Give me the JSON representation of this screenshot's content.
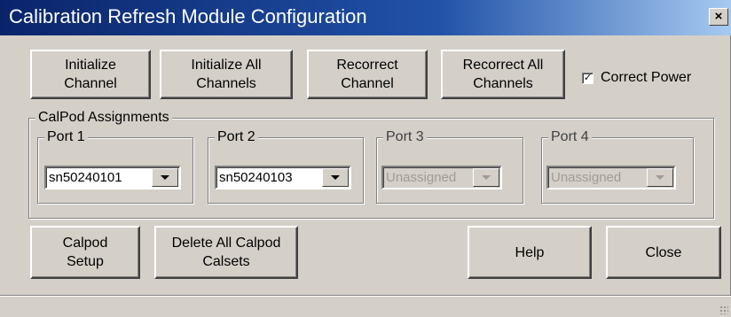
{
  "window": {
    "title": "Calibration Refresh Module Configuration",
    "close_label": "×"
  },
  "toolbar": {
    "initialize_channel": "Initialize\nChannel",
    "initialize_all_channels": "Initialize All\nChannels",
    "recorrect_channel": "Recorrect\nChannel",
    "recorrect_all_channels": "Recorrect All\nChannels",
    "correct_power_label": "Correct Power",
    "correct_power_checked": true,
    "check_mark": "✓"
  },
  "calpod": {
    "group_label": "CalPod Assignments",
    "ports": [
      {
        "label": "Port 1",
        "value": "sn50240101",
        "enabled": true
      },
      {
        "label": "Port 2",
        "value": "sn50240103",
        "enabled": true
      },
      {
        "label": "Port 3",
        "value": "Unassigned",
        "enabled": false
      },
      {
        "label": "Port 4",
        "value": "Unassigned",
        "enabled": false
      }
    ]
  },
  "footer": {
    "calpod_setup": "Calpod\nSetup",
    "delete_calsets": "Delete All Calpod\nCalsets",
    "help": "Help",
    "close": "Close"
  }
}
